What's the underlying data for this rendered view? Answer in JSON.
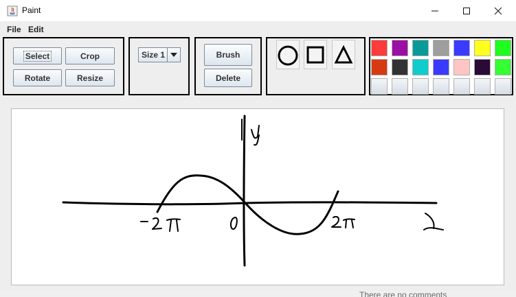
{
  "window": {
    "title": "Paint",
    "controls": {
      "minimize": "—",
      "maximize": "☐",
      "close": "✕"
    }
  },
  "menu": {
    "items": [
      "File",
      "Edit"
    ]
  },
  "tools": {
    "select": "Select",
    "crop": "Crop",
    "rotate": "Rotate",
    "resize": "Resize"
  },
  "size": {
    "selected": "Size 1"
  },
  "actions": {
    "brush": "Brush",
    "delete": "Delete"
  },
  "shapes": [
    "circle",
    "square",
    "triangle"
  ],
  "palette": {
    "row1": [
      "#ff3b3b",
      "#9b0fa4",
      "#0a9a9a",
      "#9e9e9e",
      "#3b3bff",
      "#ffff1e",
      "#1eff1e"
    ],
    "row2": [
      "#d63a12",
      "#333333",
      "#11cccc",
      "#3b3bff",
      "#ffc4c4",
      "#2a0a36",
      "#33ff33"
    ],
    "row3": [
      "#e2e6ec",
      "#e2e6ec",
      "#e2e6ec",
      "#e2e6ec",
      "#e2e6ec",
      "#e2e6ec",
      "#e2e6ec"
    ]
  },
  "drawing": {
    "labels": {
      "y": "y",
      "x": "x",
      "origin": "0",
      "neg": "-2π",
      "pos": "2π"
    }
  },
  "footer": {
    "text": "There are no comments"
  }
}
